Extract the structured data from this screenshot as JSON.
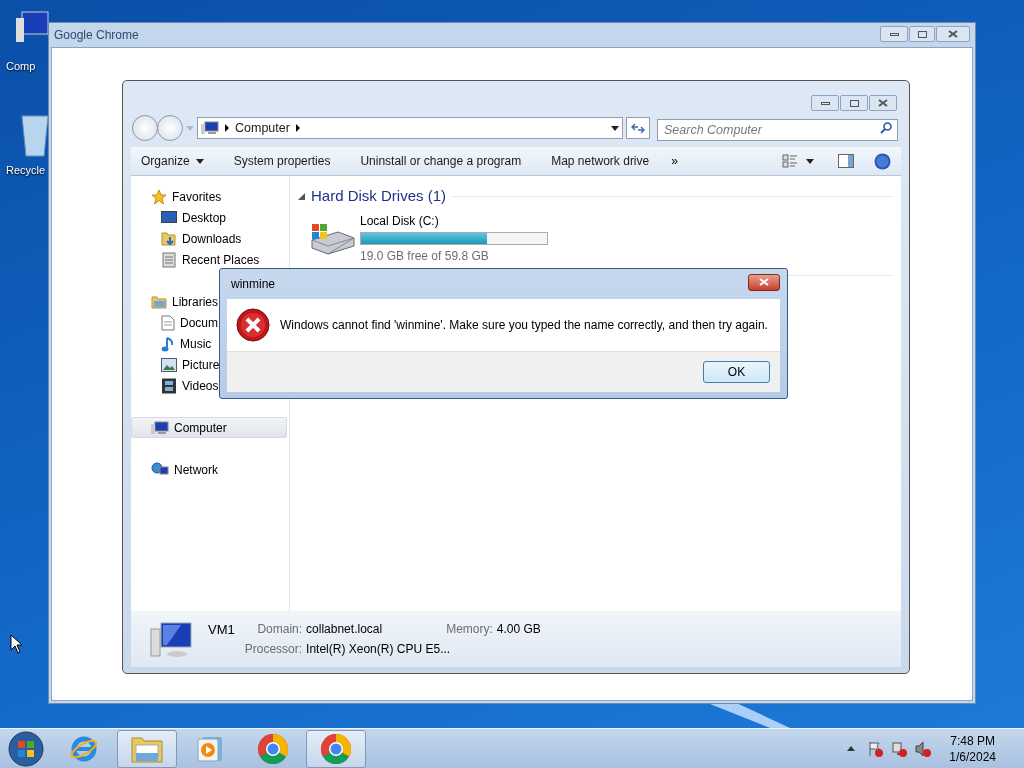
{
  "desktop_icons": [
    {
      "label": "Comp"
    },
    {
      "label": "Recycle"
    }
  ],
  "chrome_window": {
    "title": "Google Chrome"
  },
  "explorer": {
    "address": {
      "crumb": "Computer"
    },
    "search": {
      "placeholder": "Search Computer"
    },
    "toolbar": [
      {
        "label": "Organize",
        "dropdown": true
      },
      {
        "label": "System properties",
        "dropdown": false
      },
      {
        "label": "Uninstall or change a program",
        "dropdown": false
      },
      {
        "label": "Map network drive",
        "dropdown": false
      }
    ],
    "toolbar_overflow": "»",
    "nav_groups": [
      {
        "label": "Favorites",
        "selected": false,
        "children": [
          {
            "label": "Desktop",
            "selected": false
          },
          {
            "label": "Downloads",
            "selected": false
          },
          {
            "label": "Recent Places",
            "selected": false
          }
        ]
      },
      {
        "label": "Libraries",
        "selected": false,
        "children": [
          {
            "label": "Docum",
            "selected": false
          },
          {
            "label": "Music",
            "selected": false
          },
          {
            "label": "Picture",
            "selected": false
          },
          {
            "label": "Videos",
            "selected": false
          }
        ]
      },
      {
        "label": "Computer",
        "selected": true
      },
      {
        "label": "Network",
        "selected": false
      }
    ],
    "section": {
      "title": "Hard Disk Drives (1)",
      "expanded": true
    },
    "drives": [
      {
        "name": "Local Disk (C:)",
        "level": 0.68,
        "space": "19.0 GB free of 59.8 GB"
      }
    ],
    "details": {
      "name": "VM1",
      "fields": [
        {
          "label": "Domain:",
          "value": "collabnet.local"
        },
        {
          "label": "Memory:",
          "value": "4.00 GB"
        },
        {
          "label": "Processor:",
          "value": "Intel(R) Xeon(R) CPU E5..."
        }
      ]
    }
  },
  "dialog": {
    "title": "winmine",
    "message": "Windows cannot find 'winmine'. Make sure you typed the name correctly, and then try again.",
    "button": "OK"
  },
  "taskbar": {
    "items": [
      {
        "kind": "ie",
        "active": false
      },
      {
        "kind": "explorer",
        "active": true
      },
      {
        "kind": "media",
        "active": false
      },
      {
        "kind": "chrome",
        "active": false
      },
      {
        "kind": "chrome",
        "active": true
      }
    ],
    "time": "7:48 PM",
    "date": "1/6/2024"
  }
}
